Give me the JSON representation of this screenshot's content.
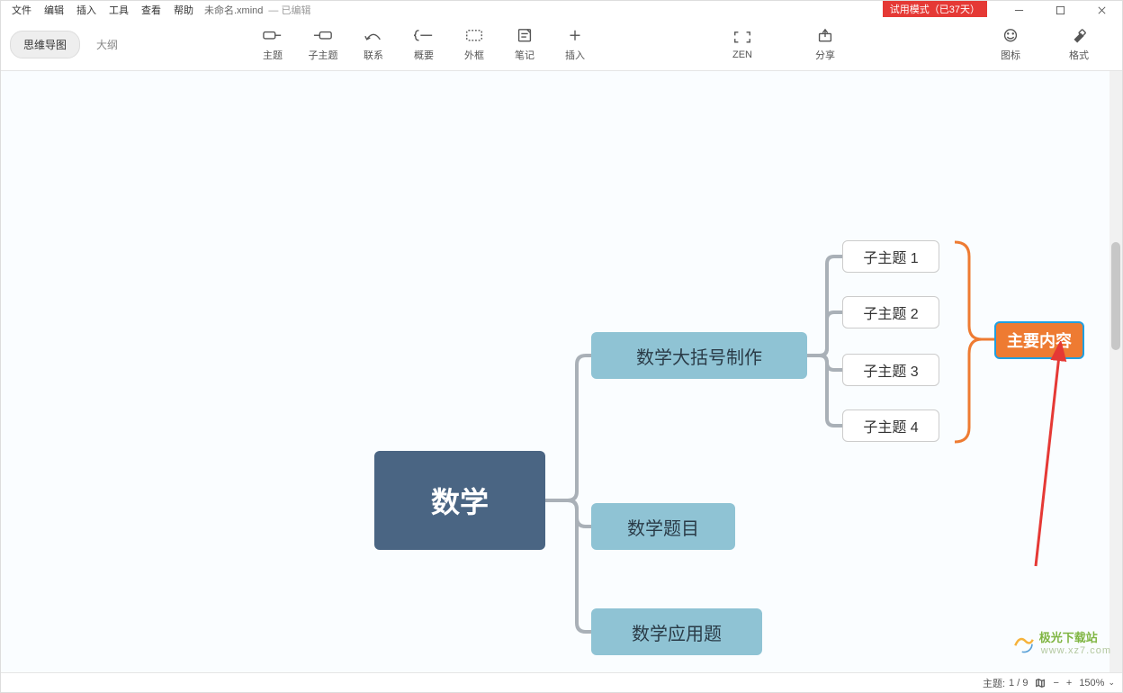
{
  "menu": {
    "file": "文件",
    "edit": "编辑",
    "insert": "插入",
    "tools": "工具",
    "view": "查看",
    "help": "帮助",
    "doc_title": "未命名.xmind",
    "doc_status": "— 已编辑"
  },
  "window": {
    "trial_badge": "试用模式（已37天）"
  },
  "toolbar": {
    "mindmap_view": "思维导图",
    "outline_view": "大纲",
    "topic": "主题",
    "subtopic": "子主题",
    "relation": "联系",
    "summary": "概要",
    "boundary": "外框",
    "notes": "笔记",
    "insert": "插入",
    "zen": "ZEN",
    "share": "分享",
    "emoji": "图标",
    "format": "格式"
  },
  "mindmap": {
    "root": "数学",
    "branch1": "数学大括号制作",
    "branch2": "数学题目",
    "branch3": "数学应用题",
    "sub1": "子主题 1",
    "sub2": "子主题 2",
    "sub3": "子主题 3",
    "sub4": "子主题 4",
    "summary": "主要内容"
  },
  "statusbar": {
    "topic_label": "主题:",
    "topic_count": "1 / 9",
    "zoom": "150%"
  },
  "watermark": {
    "name": "极光下载站",
    "sub": "www.xz7.com"
  }
}
